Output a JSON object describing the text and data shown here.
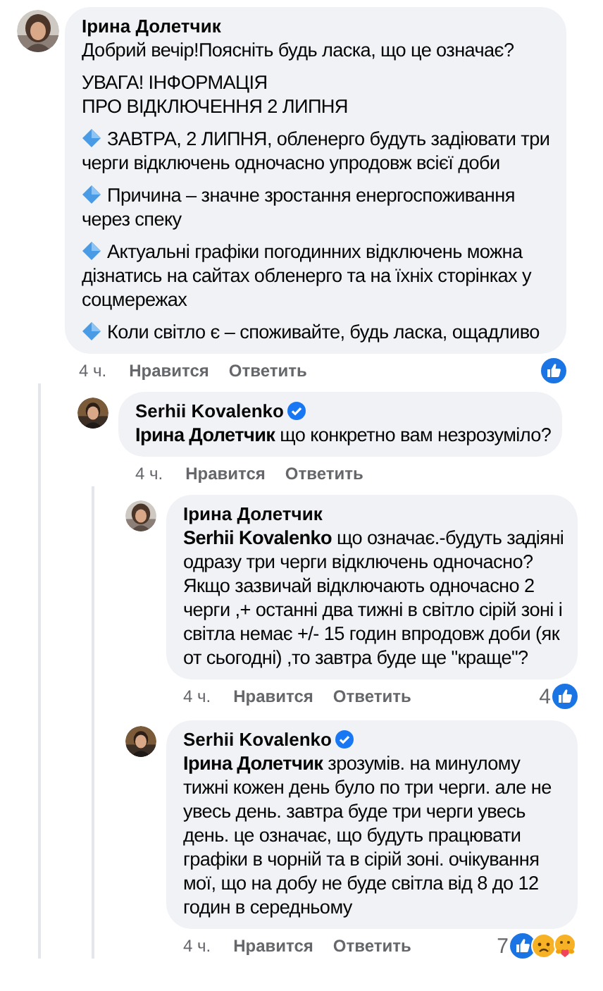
{
  "comments": [
    {
      "author": "Ірина Долетчик",
      "verified": false,
      "paragraphs": [
        {
          "kind": "text",
          "text": "Добрий вечір!Поясніть будь ласка, що це означає?"
        },
        {
          "kind": "text",
          "text": "УВАГА! ІНФОРМАЦІЯ\nПРО ВІДКЛЮЧЕННЯ 2 ЛИПНЯ"
        },
        {
          "kind": "bullet",
          "text": "ЗАВТРА, 2 ЛИПНЯ, обленерго будуть задіювати три черги відключень одночасно упродовж всієї доби"
        },
        {
          "kind": "bullet",
          "text": "Причина – значне зростання енергоспоживання через спеку"
        },
        {
          "kind": "bullet",
          "text": "Актуальні графіки погодинних відключень можна дізнатись на сайтах обленерго та на їхніх сторінках у соцмережах"
        },
        {
          "kind": "bullet",
          "text": "Коли світло є – споживайте, будь ласка, ощадливо"
        }
      ],
      "time": "4 ч.",
      "like": "Нравится",
      "reply": "Ответить",
      "reactions": [
        {
          "kind": "like"
        }
      ],
      "children": [
        {
          "author": "Serhii Kovalenko",
          "verified": true,
          "paragraphs": [
            {
              "kind": "text",
              "text": "**Ірина Долетчик** що конкретно вам незрозуміло?"
            }
          ],
          "time": "4 ч.",
          "like": "Нравится",
          "reply": "Ответить",
          "children": [
            {
              "author": "Ірина Долетчик",
              "verified": false,
              "paragraphs": [
                {
                  "kind": "text",
                  "text": "**Serhii Kovalenko** що означає.-будуть задіяні одразу три черги відключень одночасно? Якщо зазвичай відключають одночасно 2 черги ,+ останні два тижні в світло сірій зоні і світла немає +/- 15 годин впродовж доби (як от сьогодні) ,то завтра буде ще \"краще\"?"
                }
              ],
              "time": "4 ч.",
              "like": "Нравится",
              "reply": "Ответить",
              "reaction_count": "4",
              "reactions": [
                {
                  "kind": "like"
                }
              ]
            },
            {
              "author": "Serhii Kovalenko",
              "verified": true,
              "paragraphs": [
                {
                  "kind": "text",
                  "text": "**Ірина Долетчик** зрозумів. на минулому тижні кожен день було по три черги. але не увесь день. завтра буде три черги увесь день. це означає, що будуть працювати графіки в чорній та в сірій зоні. очікування мої, що на добу не буде світла від 8 до 12 годин в середньому"
                }
              ],
              "time": "4 ч.",
              "like": "Нравится",
              "reply": "Ответить",
              "reaction_count": "7",
              "reactions": [
                {
                  "kind": "like"
                },
                {
                  "kind": "sad"
                },
                {
                  "kind": "care"
                }
              ]
            }
          ]
        }
      ]
    }
  ]
}
